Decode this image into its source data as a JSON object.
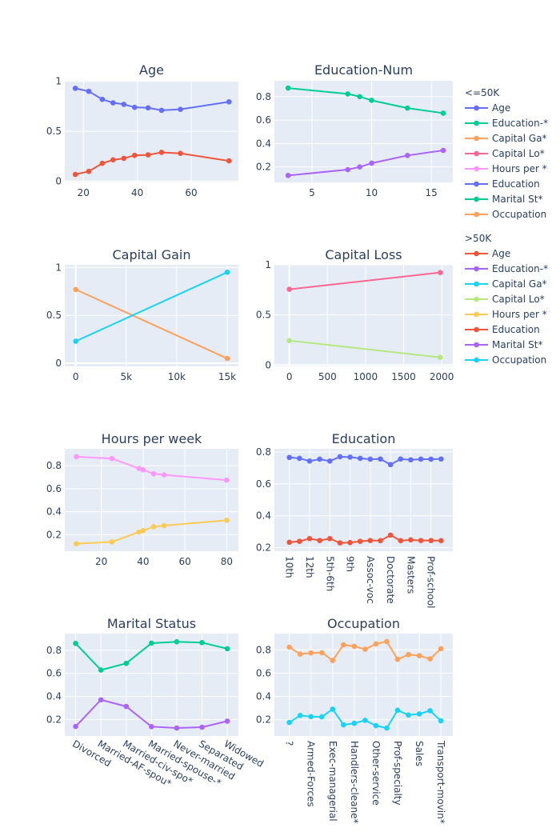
{
  "legend": {
    "groups": [
      {
        "title": "<=50K",
        "items": [
          {
            "label": "Age",
            "color": "#636efa"
          },
          {
            "label": "Education-*",
            "color": "#00cc96"
          },
          {
            "label": "Capital Ga*",
            "color": "#FFA15A"
          },
          {
            "label": "Capital Lo*",
            "color": "#FF6692"
          },
          {
            "label": "Hours per *",
            "color": "#FF97FF"
          },
          {
            "label": "Education",
            "color": "#636efa"
          },
          {
            "label": "Marital St*",
            "color": "#00cc96"
          },
          {
            "label": "Occupation",
            "color": "#FFA15A"
          }
        ]
      },
      {
        "title": ">50K",
        "items": [
          {
            "label": "Age",
            "color": "#EF553B"
          },
          {
            "label": "Education-*",
            "color": "#ab63fa"
          },
          {
            "label": "Capital Ga*",
            "color": "#19d3f3"
          },
          {
            "label": "Capital Lo*",
            "color": "#B6E880"
          },
          {
            "label": "Hours per *",
            "color": "#FECB52"
          },
          {
            "label": "Education",
            "color": "#EF553B"
          },
          {
            "label": "Marital St*",
            "color": "#ab63fa"
          },
          {
            "label": "Occupation",
            "color": "#19d3f3"
          }
        ]
      }
    ]
  },
  "chart_data": [
    {
      "type": "line",
      "title": "Age",
      "grid": true,
      "x": [
        17,
        22,
        27,
        31,
        35,
        39,
        44,
        49,
        56,
        74
      ],
      "xlim": [
        13.1,
        77.5
      ],
      "ylim": [
        -0.01,
        1.005
      ],
      "xticks": [
        20,
        40,
        60
      ],
      "xtick_labels": [
        "20",
        "40",
        "60"
      ],
      "yticks": [
        0,
        0.5,
        1
      ],
      "ytick_labels": [
        "0",
        "0.5",
        "1"
      ],
      "series": [
        {
          "name": "<=50K",
          "color": "#636efa",
          "values": [
            0.93,
            0.9,
            0.82,
            0.785,
            0.77,
            0.74,
            0.735,
            0.71,
            0.72,
            0.795
          ]
        },
        {
          "name": ">50K",
          "color": "#EF553B",
          "values": [
            0.07,
            0.1,
            0.18,
            0.215,
            0.23,
            0.26,
            0.265,
            0.29,
            0.28,
            0.205
          ]
        }
      ]
    },
    {
      "type": "line",
      "title": "Education-Num",
      "grid": true,
      "x": [
        3,
        8,
        9,
        10,
        13,
        16
      ],
      "xlim": [
        1.85,
        16.8
      ],
      "ylim": [
        0.068,
        0.935
      ],
      "xticks": [
        5,
        10,
        15
      ],
      "xtick_labels": [
        "5",
        "10",
        "15"
      ],
      "yticks": [
        0.2,
        0.4,
        0.6,
        0.8
      ],
      "ytick_labels": [
        "0.2",
        "0.4",
        "0.6",
        "0.8"
      ],
      "series": [
        {
          "name": "<=50K",
          "color": "#00cc96",
          "values": [
            0.873,
            0.823,
            0.8,
            0.768,
            0.702,
            0.659
          ]
        },
        {
          "name": ">50K",
          "color": "#ab63fa",
          "values": [
            0.127,
            0.177,
            0.2,
            0.232,
            0.298,
            0.341
          ]
        }
      ]
    },
    {
      "type": "line",
      "title": "Capital Gain",
      "grid": true,
      "x": [
        0,
        15000
      ],
      "xlim": [
        -1085,
        16110
      ],
      "ylim": [
        -0.033,
        1.028
      ],
      "xticks": [
        0,
        5000,
        10000,
        15000
      ],
      "xtick_labels": [
        "0",
        "5k",
        "10k",
        "15k"
      ],
      "yticks": [
        0,
        0.5,
        1
      ],
      "ytick_labels": [
        "0",
        "0.5",
        "1"
      ],
      "series": [
        {
          "name": "<=50K",
          "color": "#FFA15A",
          "values": [
            0.77,
            0.05
          ]
        },
        {
          "name": ">50K",
          "color": "#19d3f3",
          "values": [
            0.23,
            0.95
          ]
        }
      ]
    },
    {
      "type": "line",
      "title": "Capital Loss",
      "grid": true,
      "x": [
        0,
        1980
      ],
      "xlim": [
        -196,
        2145
      ],
      "ylim": [
        -0.013,
        1.0
      ],
      "xticks": [
        0,
        500,
        1000,
        1500,
        2000
      ],
      "xtick_labels": [
        "0",
        "500",
        "1000",
        "1500",
        "2000"
      ],
      "yticks": [
        0,
        0.5,
        1
      ],
      "ytick_labels": [
        "0",
        "0.5",
        "1"
      ],
      "series": [
        {
          "name": "<=50K",
          "color": "#FF6692",
          "values": [
            0.756,
            0.923
          ]
        },
        {
          "name": ">50K",
          "color": "#B6E880",
          "values": [
            0.244,
            0.077
          ]
        }
      ]
    },
    {
      "type": "line",
      "title": "Hours per week",
      "grid": true,
      "x": [
        8,
        25,
        38,
        40,
        45,
        50,
        80
      ],
      "xlim": [
        2.5,
        85.6
      ],
      "ylim": [
        0.056,
        0.948
      ],
      "xticks": [
        20,
        40,
        60,
        80
      ],
      "xtick_labels": [
        "20",
        "40",
        "60",
        "80"
      ],
      "yticks": [
        0.2,
        0.4,
        0.6,
        0.8
      ],
      "ytick_labels": [
        "0.2",
        "0.4",
        "0.6",
        "0.8"
      ],
      "series": [
        {
          "name": "<=50K",
          "color": "#FF97FF",
          "values": [
            0.879,
            0.863,
            0.777,
            0.765,
            0.731,
            0.721,
            0.675
          ]
        },
        {
          "name": ">50K",
          "color": "#FECB52",
          "values": [
            0.121,
            0.137,
            0.223,
            0.235,
            0.269,
            0.279,
            0.325
          ]
        }
      ]
    },
    {
      "type": "line",
      "title": "Education",
      "grid": true,
      "categorical": true,
      "label_every": 2,
      "label_rotation": 90,
      "xtick_labels": [
        "10th",
        "12th",
        "5th-6th",
        "9th",
        "Assoc-voc",
        "Doctorate",
        "Masters",
        "Prof-school"
      ],
      "xlim": [
        -1.48,
        16.16
      ],
      "ylim": [
        0.178,
        0.82
      ],
      "yticks": [
        0.2,
        0.4,
        0.6,
        0.8
      ],
      "ytick_labels": [
        "0.2",
        "0.4",
        "0.6",
        "0.8"
      ],
      "series": [
        {
          "name": "<=50K",
          "color": "#636efa",
          "values": [
            0.766,
            0.76,
            0.743,
            0.755,
            0.743,
            0.77,
            0.768,
            0.76,
            0.755,
            0.756,
            0.721,
            0.756,
            0.751,
            0.755,
            0.755,
            0.756
          ]
        },
        {
          "name": ">50K",
          "color": "#EF553B",
          "values": [
            0.234,
            0.24,
            0.257,
            0.245,
            0.257,
            0.23,
            0.232,
            0.24,
            0.245,
            0.244,
            0.279,
            0.244,
            0.249,
            0.245,
            0.245,
            0.244
          ]
        }
      ]
    },
    {
      "type": "line",
      "title": "Marital Status",
      "grid": true,
      "categorical": true,
      "label_every": 1,
      "label_rotation": 30,
      "xtick_labels": [
        "Divorced",
        "Married-AF-spou*",
        "Married-civ-spo*",
        "Married-spouse-*",
        "Never-married",
        "Separated",
        "Widowed"
      ],
      "xlim": [
        -0.43,
        6.44
      ],
      "ylim": [
        0.057,
        0.945
      ],
      "yticks": [
        0.2,
        0.4,
        0.6,
        0.8
      ],
      "ytick_labels": [
        "0.2",
        "0.4",
        "0.6",
        "0.8"
      ],
      "series": [
        {
          "name": "<=50K",
          "color": "#00cc96",
          "values": [
            0.86,
            0.629,
            0.687,
            0.862,
            0.874,
            0.867,
            0.814
          ]
        },
        {
          "name": ">50K",
          "color": "#ab63fa",
          "values": [
            0.14,
            0.371,
            0.313,
            0.138,
            0.126,
            0.133,
            0.186
          ]
        }
      ]
    },
    {
      "type": "line",
      "title": "Occupation",
      "grid": true,
      "categorical": true,
      "label_every": 2,
      "label_rotation": 90,
      "xtick_labels": [
        "?",
        "Armed-Forces",
        "Exec-managerial",
        "Handlers-cleane*",
        "Other-service",
        "Prof-specialty",
        "Sales",
        "Transport-movin*"
      ],
      "xlim": [
        -1.38,
        15.1
      ],
      "ylim": [
        0.061,
        0.939
      ],
      "yticks": [
        0.2,
        0.4,
        0.6,
        0.8
      ],
      "ytick_labels": [
        "0.2",
        "0.4",
        "0.6",
        "0.8"
      ],
      "series": [
        {
          "name": "<=50K",
          "color": "#FFA15A",
          "values": [
            0.823,
            0.763,
            0.773,
            0.775,
            0.709,
            0.843,
            0.83,
            0.805,
            0.85,
            0.871,
            0.718,
            0.759,
            0.75,
            0.722,
            0.809
          ]
        },
        {
          "name": ">50K",
          "color": "#19d3f3",
          "values": [
            0.177,
            0.237,
            0.227,
            0.225,
            0.291,
            0.157,
            0.17,
            0.195,
            0.15,
            0.129,
            0.282,
            0.241,
            0.25,
            0.278,
            0.191
          ]
        }
      ]
    }
  ]
}
